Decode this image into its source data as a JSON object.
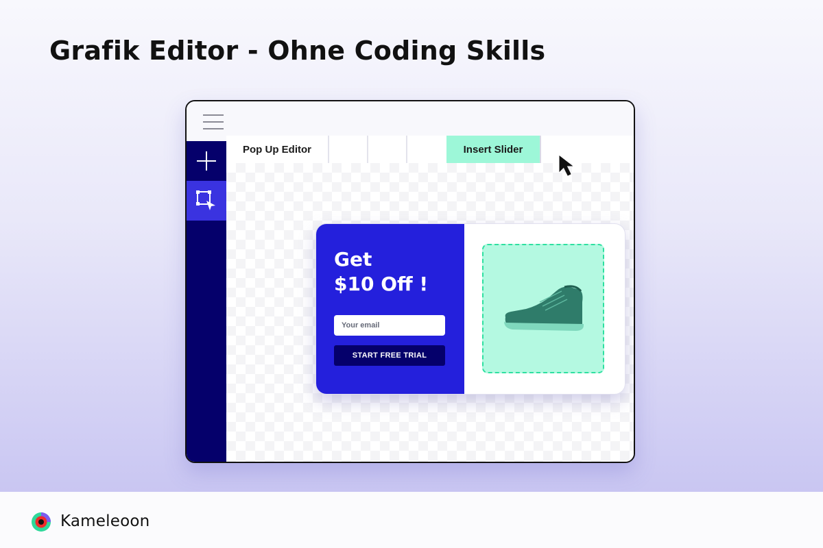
{
  "headline": "Grafik Editor - Ohne Coding Skills",
  "editor": {
    "tabs": [
      {
        "label": "Pop Up Editor"
      },
      {
        "label": ""
      },
      {
        "label": ""
      },
      {
        "label": ""
      },
      {
        "label": "Insert Slider"
      }
    ],
    "sidebar": [
      {
        "icon": "plus-icon"
      },
      {
        "icon": "select-transform-icon",
        "active": true
      }
    ],
    "highlight_color": "#9df7d8",
    "sidebar_color": "#05006b"
  },
  "popup": {
    "title_line1": "Get",
    "title_line2": "$10 Off !",
    "email_placeholder": "Your email",
    "cta_label": "START FREE TRIAL",
    "image_alt": "sneaker",
    "accent_color": "#2420dc"
  },
  "brand": {
    "name": "Kameleoon"
  }
}
